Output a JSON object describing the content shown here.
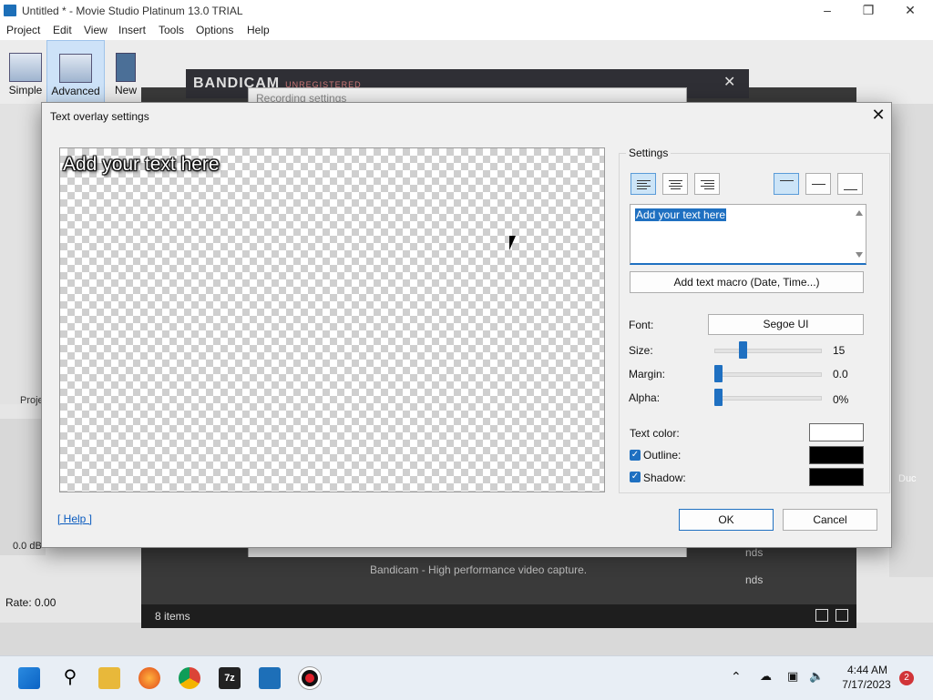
{
  "app": {
    "title": "Untitled * - Movie Studio Platinum 13.0 TRIAL",
    "menu": [
      "Project",
      "Edit",
      "View",
      "Insert",
      "Tools",
      "Options",
      "Help"
    ],
    "toolbar": {
      "simple": "Simple",
      "advanced": "Advanced",
      "new": "New"
    },
    "left_label": "Proje",
    "volume": "0.0 dB",
    "rate": "Rate: 0.00"
  },
  "background": {
    "bandicam_logo": "BANDICAM",
    "bandicam_reg": "UNREGISTERED",
    "recording_title": "Recording settings",
    "footer_text": "Bandicam - High performance video capture.",
    "items_count": "8 items",
    "side_text_1": "nds",
    "side_text_2": "nds",
    "right_text": "Duc"
  },
  "dialog": {
    "title": "Text overlay settings",
    "preview_text": "Add your text here",
    "settings_legend": "Settings",
    "text_value": "Add your text here",
    "macro_button": "Add text macro (Date, Time...)",
    "font_label": "Font:",
    "font_value": "Segoe UI",
    "size_label": "Size:",
    "size_value": "15",
    "margin_label": "Margin:",
    "margin_value": "0.0",
    "alpha_label": "Alpha:",
    "alpha_value": "0%",
    "text_color_label": "Text color:",
    "outline_label": "Outline:",
    "shadow_label": "Shadow:",
    "help_link": "[ Help ]",
    "ok": "OK",
    "cancel": "Cancel",
    "colors": {
      "text_color": "#ffffff",
      "outline_color": "#000000",
      "shadow_color": "#000000"
    },
    "sliders": {
      "size_fraction": 0.28,
      "margin_fraction": 0.0,
      "alpha_fraction": 0.0
    },
    "outline_checked": true,
    "shadow_checked": true
  },
  "taskbar": {
    "time": "4:44 AM",
    "date": "7/17/2023",
    "notifications": "2",
    "sevenzip": "7z"
  }
}
